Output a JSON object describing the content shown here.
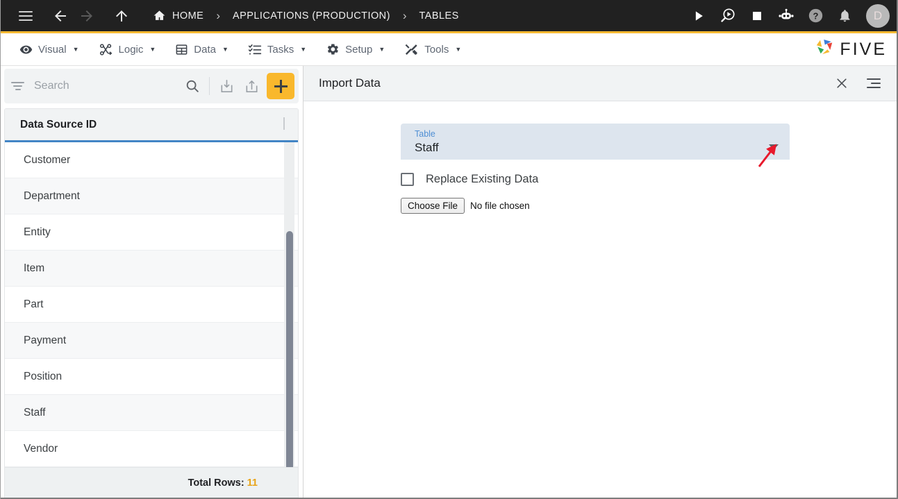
{
  "topbar": {
    "menu_icon": "hamburger-icon",
    "back_icon": "arrow-left-icon",
    "forward_icon": "arrow-right-icon",
    "up_icon": "arrow-up-icon",
    "breadcrumbs": [
      {
        "label": "HOME",
        "icon": "home-icon"
      },
      {
        "label": "APPLICATIONS (PRODUCTION)",
        "icon": ""
      },
      {
        "label": "TABLES",
        "icon": ""
      }
    ],
    "separator": "›",
    "actions": [
      {
        "name": "run-icon",
        "title": "Run"
      },
      {
        "name": "debug-icon",
        "title": "Debug"
      },
      {
        "name": "stop-icon",
        "title": "Stop"
      },
      {
        "name": "robot-icon",
        "title": "Assistant"
      },
      {
        "name": "help-icon",
        "title": "Help"
      },
      {
        "name": "bell-icon",
        "title": "Notifications"
      }
    ],
    "avatar_initial": "D"
  },
  "menubar": {
    "items": [
      {
        "label": "Visual",
        "icon": "eye-icon"
      },
      {
        "label": "Logic",
        "icon": "nodes-icon"
      },
      {
        "label": "Data",
        "icon": "table-icon"
      },
      {
        "label": "Tasks",
        "icon": "checklist-icon"
      },
      {
        "label": "Setup",
        "icon": "gear-icon"
      },
      {
        "label": "Tools",
        "icon": "tools-icon"
      }
    ],
    "caret": "▼",
    "brand": "FIVE"
  },
  "sidebar": {
    "search": {
      "placeholder": "Search",
      "value": ""
    },
    "toolbar": [
      {
        "name": "filter-icon",
        "label": "Filter"
      },
      {
        "name": "search-icon",
        "label": "Search"
      },
      {
        "name": "import-icon",
        "label": "Import"
      },
      {
        "name": "export-icon",
        "label": "Export"
      },
      {
        "name": "add-icon",
        "label": "+"
      }
    ],
    "grid": {
      "column_header": "Data Source ID",
      "rows": [
        "Customer",
        "Department",
        "Entity",
        "Item",
        "Part",
        "Payment",
        "Position",
        "Staff",
        "Vendor"
      ]
    },
    "total_label": "Total Rows:",
    "total_value": "11"
  },
  "panel": {
    "title": "Import Data",
    "close_label": "✕",
    "menu_icon": "list-menu-icon",
    "form": {
      "table_field": {
        "label": "Table",
        "value": "Staff",
        "caret": "▾"
      },
      "replace_checkbox": {
        "label": "Replace Existing Data",
        "checked": false
      },
      "file_input": {
        "button_label": "Choose File",
        "status": "No file chosen"
      }
    }
  },
  "colors": {
    "topbar_bg": "#212121",
    "accent_yellow": "#f5b932",
    "header_underline_blue": "#4285c5",
    "field_bg": "#dde5ee",
    "field_label_blue": "#4f8fd4",
    "total_number": "#e8a317",
    "annotation_red": "#e8192c"
  }
}
